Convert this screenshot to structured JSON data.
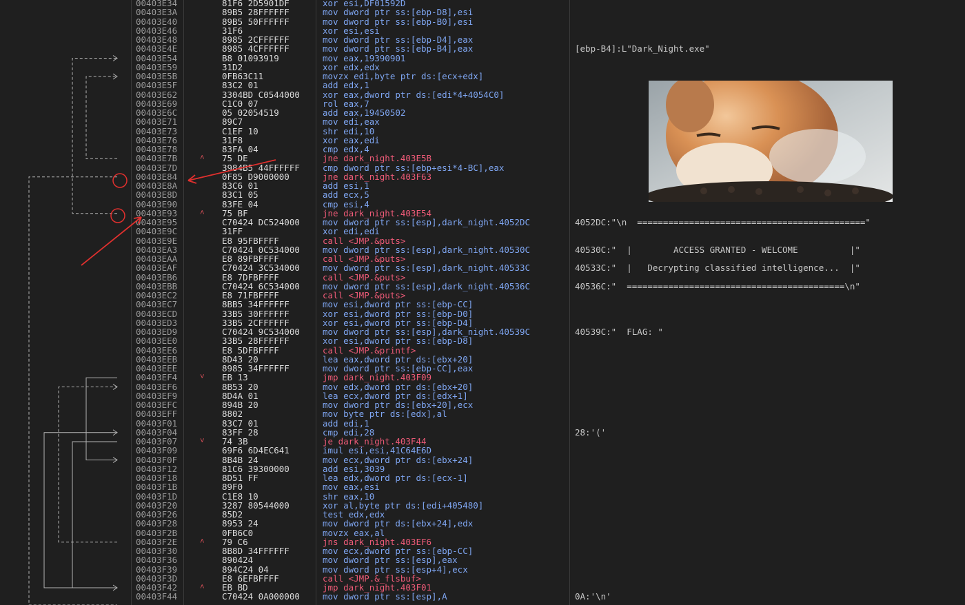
{
  "listing": [
    {
      "addr": "00403E34",
      "bytes": "81F6 2D5901DF",
      "instr": "xor esi,DF01592D",
      "mark": "",
      "comment": ""
    },
    {
      "addr": "00403E3A",
      "bytes": "89B5 28FFFFFF",
      "instr": "mov dword ptr ss:[ebp-D8],esi",
      "mark": "",
      "comment": ""
    },
    {
      "addr": "00403E40",
      "bytes": "89B5 50FFFFFF",
      "instr": "mov dword ptr ss:[ebp-B0],esi",
      "mark": "",
      "comment": ""
    },
    {
      "addr": "00403E46",
      "bytes": "31F6",
      "instr": "xor esi,esi",
      "mark": "",
      "comment": ""
    },
    {
      "addr": "00403E48",
      "bytes": "8985 2CFFFFFF",
      "instr": "mov dword ptr ss:[ebp-D4],eax",
      "mark": "",
      "comment": ""
    },
    {
      "addr": "00403E4E",
      "bytes": "8985 4CFFFFFF",
      "instr": "mov dword ptr ss:[ebp-B4],eax",
      "mark": "",
      "comment": "[ebp-B4]:L\"Dark_Night.exe\""
    },
    {
      "addr": "00403E54",
      "bytes": "B8 01093919",
      "instr": "mov eax,19390901",
      "mark": "",
      "comment": ""
    },
    {
      "addr": "00403E59",
      "bytes": "31D2",
      "instr": "xor edx,edx",
      "mark": "",
      "comment": ""
    },
    {
      "addr": "00403E5B",
      "bytes": "0FB63C11",
      "instr": "movzx edi,byte ptr ds:[ecx+edx]",
      "mark": "",
      "comment": ""
    },
    {
      "addr": "00403E5F",
      "bytes": "83C2 01",
      "instr": "add edx,1",
      "mark": "",
      "comment": ""
    },
    {
      "addr": "00403E62",
      "bytes": "3304BD C0544000",
      "instr": "xor eax,dword ptr ds:[edi*4+4054C0]",
      "mark": "",
      "comment": ""
    },
    {
      "addr": "00403E69",
      "bytes": "C1C0 07",
      "instr": "rol eax,7",
      "mark": "",
      "comment": ""
    },
    {
      "addr": "00403E6C",
      "bytes": "05 02054519",
      "instr": "add eax,19450502",
      "mark": "",
      "comment": ""
    },
    {
      "addr": "00403E71",
      "bytes": "89C7",
      "instr": "mov edi,eax",
      "mark": "",
      "comment": ""
    },
    {
      "addr": "00403E73",
      "bytes": "C1EF 10",
      "instr": "shr edi,10",
      "mark": "",
      "comment": ""
    },
    {
      "addr": "00403E76",
      "bytes": "31F8",
      "instr": "xor eax,edi",
      "mark": "",
      "comment": ""
    },
    {
      "addr": "00403E78",
      "bytes": "83FA 04",
      "instr": "cmp edx,4",
      "mark": "",
      "comment": ""
    },
    {
      "addr": "00403E7B",
      "bytes": "75 DE",
      "instr": "jne dark_night.403E5B",
      "mark": "^",
      "comment": ""
    },
    {
      "addr": "00403E7D",
      "bytes": "3984B5 44FFFFFF",
      "instr": "cmp dword ptr ss:[ebp+esi*4-BC],eax",
      "mark": "",
      "comment": ""
    },
    {
      "addr": "00403E84",
      "bytes": "0F85 D9000000",
      "instr": "jne dark_night.403F63",
      "mark": "",
      "comment": ""
    },
    {
      "addr": "00403E8A",
      "bytes": "83C6 01",
      "instr": "add esi,1",
      "mark": "",
      "comment": ""
    },
    {
      "addr": "00403E8D",
      "bytes": "83C1 05",
      "instr": "add ecx,5",
      "mark": "",
      "comment": ""
    },
    {
      "addr": "00403E90",
      "bytes": "83FE 04",
      "instr": "cmp esi,4",
      "mark": "",
      "comment": ""
    },
    {
      "addr": "00403E93",
      "bytes": "75 BF",
      "instr": "jne dark_night.403E54",
      "mark": "^",
      "comment": ""
    },
    {
      "addr": "00403E95",
      "bytes": "C70424 DC524000",
      "instr": "mov dword ptr ss:[esp],dark_night.4052DC",
      "mark": "",
      "comment": "4052DC:\"\\n  ============================================\""
    },
    {
      "addr": "00403E9C",
      "bytes": "31FF",
      "instr": "xor edi,edi",
      "mark": "",
      "comment": ""
    },
    {
      "addr": "00403E9E",
      "bytes": "E8 95FBFFFF",
      "instr": "call <JMP.&puts>",
      "mark": "",
      "comment": ""
    },
    {
      "addr": "00403EA3",
      "bytes": "C70424 0C534000",
      "instr": "mov dword ptr ss:[esp],dark_night.40530C",
      "mark": "",
      "comment": "40530C:\"  |        ACCESS GRANTED - WELCOME          |\""
    },
    {
      "addr": "00403EAA",
      "bytes": "E8 89FBFFFF",
      "instr": "call <JMP.&puts>",
      "mark": "",
      "comment": ""
    },
    {
      "addr": "00403EAF",
      "bytes": "C70424 3C534000",
      "instr": "mov dword ptr ss:[esp],dark_night.40533C",
      "mark": "",
      "comment": "40533C:\"  |   Decrypting classified intelligence...  |\""
    },
    {
      "addr": "00403EB6",
      "bytes": "E8 7DFBFFFF",
      "instr": "call <JMP.&puts>",
      "mark": "",
      "comment": ""
    },
    {
      "addr": "00403EBB",
      "bytes": "C70424 6C534000",
      "instr": "mov dword ptr ss:[esp],dark_night.40536C",
      "mark": "",
      "comment": "40536C:\"  ==========================================\\n\""
    },
    {
      "addr": "00403EC2",
      "bytes": "E8 71FBFFFF",
      "instr": "call <JMP.&puts>",
      "mark": "",
      "comment": ""
    },
    {
      "addr": "00403EC7",
      "bytes": "8BB5 34FFFFFF",
      "instr": "mov esi,dword ptr ss:[ebp-CC]",
      "mark": "",
      "comment": ""
    },
    {
      "addr": "00403ECD",
      "bytes": "33B5 30FFFFFF",
      "instr": "xor esi,dword ptr ss:[ebp-D0]",
      "mark": "",
      "comment": ""
    },
    {
      "addr": "00403ED3",
      "bytes": "33B5 2CFFFFFF",
      "instr": "xor esi,dword ptr ss:[ebp-D4]",
      "mark": "",
      "comment": ""
    },
    {
      "addr": "00403ED9",
      "bytes": "C70424 9C534000",
      "instr": "mov dword ptr ss:[esp],dark_night.40539C",
      "mark": "",
      "comment": "40539C:\"  FLAG: \""
    },
    {
      "addr": "00403EE0",
      "bytes": "33B5 28FFFFFF",
      "instr": "xor esi,dword ptr ss:[ebp-D8]",
      "mark": "",
      "comment": ""
    },
    {
      "addr": "00403EE6",
      "bytes": "E8 5DFBFFFF",
      "instr": "call <JMP.&printf>",
      "mark": "",
      "comment": ""
    },
    {
      "addr": "00403EEB",
      "bytes": "8D43 20",
      "instr": "lea eax,dword ptr ds:[ebx+20]",
      "mark": "",
      "comment": ""
    },
    {
      "addr": "00403EEE",
      "bytes": "8985 34FFFFFF",
      "instr": "mov dword ptr ss:[ebp-CC],eax",
      "mark": "",
      "comment": ""
    },
    {
      "addr": "00403EF4",
      "bytes": "EB 13",
      "instr": "jmp dark_night.403F09",
      "mark": "v",
      "comment": ""
    },
    {
      "addr": "00403EF6",
      "bytes": "8B53 20",
      "instr": "mov edx,dword ptr ds:[ebx+20]",
      "mark": "",
      "comment": ""
    },
    {
      "addr": "00403EF9",
      "bytes": "8D4A 01",
      "instr": "lea ecx,dword ptr ds:[edx+1]",
      "mark": "",
      "comment": ""
    },
    {
      "addr": "00403EFC",
      "bytes": "894B 20",
      "instr": "mov dword ptr ds:[ebx+20],ecx",
      "mark": "",
      "comment": ""
    },
    {
      "addr": "00403EFF",
      "bytes": "8802",
      "instr": "mov byte ptr ds:[edx],al",
      "mark": "",
      "comment": ""
    },
    {
      "addr": "00403F01",
      "bytes": "83C7 01",
      "instr": "add edi,1",
      "mark": "",
      "comment": ""
    },
    {
      "addr": "00403F04",
      "bytes": "83FF 28",
      "instr": "cmp edi,28",
      "mark": "",
      "comment": "28:'('"
    },
    {
      "addr": "00403F07",
      "bytes": "74 3B",
      "instr": "je dark_night.403F44",
      "mark": "v",
      "comment": ""
    },
    {
      "addr": "00403F09",
      "bytes": "69F6 6D4EC641",
      "instr": "imul esi,esi,41C64E6D",
      "mark": "",
      "comment": ""
    },
    {
      "addr": "00403F0F",
      "bytes": "8B4B 24",
      "instr": "mov ecx,dword ptr ds:[ebx+24]",
      "mark": "",
      "comment": ""
    },
    {
      "addr": "00403F12",
      "bytes": "81C6 39300000",
      "instr": "add esi,3039",
      "mark": "",
      "comment": ""
    },
    {
      "addr": "00403F18",
      "bytes": "8D51 FF",
      "instr": "lea edx,dword ptr ds:[ecx-1]",
      "mark": "",
      "comment": ""
    },
    {
      "addr": "00403F1B",
      "bytes": "89F0",
      "instr": "mov eax,esi",
      "mark": "",
      "comment": ""
    },
    {
      "addr": "00403F1D",
      "bytes": "C1E8 10",
      "instr": "shr eax,10",
      "mark": "",
      "comment": ""
    },
    {
      "addr": "00403F20",
      "bytes": "3287 80544000",
      "instr": "xor al,byte ptr ds:[edi+405480]",
      "mark": "",
      "comment": ""
    },
    {
      "addr": "00403F26",
      "bytes": "85D2",
      "instr": "test edx,edx",
      "mark": "",
      "comment": ""
    },
    {
      "addr": "00403F28",
      "bytes": "8953 24",
      "instr": "mov dword ptr ds:[ebx+24],edx",
      "mark": "",
      "comment": ""
    },
    {
      "addr": "00403F2B",
      "bytes": "0FB6C0",
      "instr": "movzx eax,al",
      "mark": "",
      "comment": ""
    },
    {
      "addr": "00403F2E",
      "bytes": "79 C6",
      "instr": "jns dark_night.403EF6",
      "mark": "^",
      "comment": ""
    },
    {
      "addr": "00403F30",
      "bytes": "8B8D 34FFFFFF",
      "instr": "mov ecx,dword ptr ss:[ebp-CC]",
      "mark": "",
      "comment": ""
    },
    {
      "addr": "00403F36",
      "bytes": "890424",
      "instr": "mov dword ptr ss:[esp],eax",
      "mark": "",
      "comment": ""
    },
    {
      "addr": "00403F39",
      "bytes": "894C24 04",
      "instr": "mov dword ptr ss:[esp+4],ecx",
      "mark": "",
      "comment": ""
    },
    {
      "addr": "00403F3D",
      "bytes": "E8 6EFBFFFF",
      "instr": "call <JMP.&_flsbuf>",
      "mark": "",
      "comment": ""
    },
    {
      "addr": "00403F42",
      "bytes": "EB BD",
      "instr": "jmp dark_night.403F01",
      "mark": "^",
      "comment": ""
    },
    {
      "addr": "00403F44",
      "bytes": "C70424 0A000000",
      "instr": "mov dword ptr ss:[esp],A",
      "mark": "",
      "comment": "0A:'\\n'"
    }
  ],
  "colors": {
    "background": "#1f1f1f",
    "address": "#9a9a9a",
    "bytes": "#dcdcdc",
    "instruction": "#7fa6f2",
    "branch_call": "#ef5b78",
    "comment": "#c8c8c8",
    "jump_marker": "#e0525a",
    "annotation_red": "#e0302e"
  },
  "image_icon": "cat-photo"
}
